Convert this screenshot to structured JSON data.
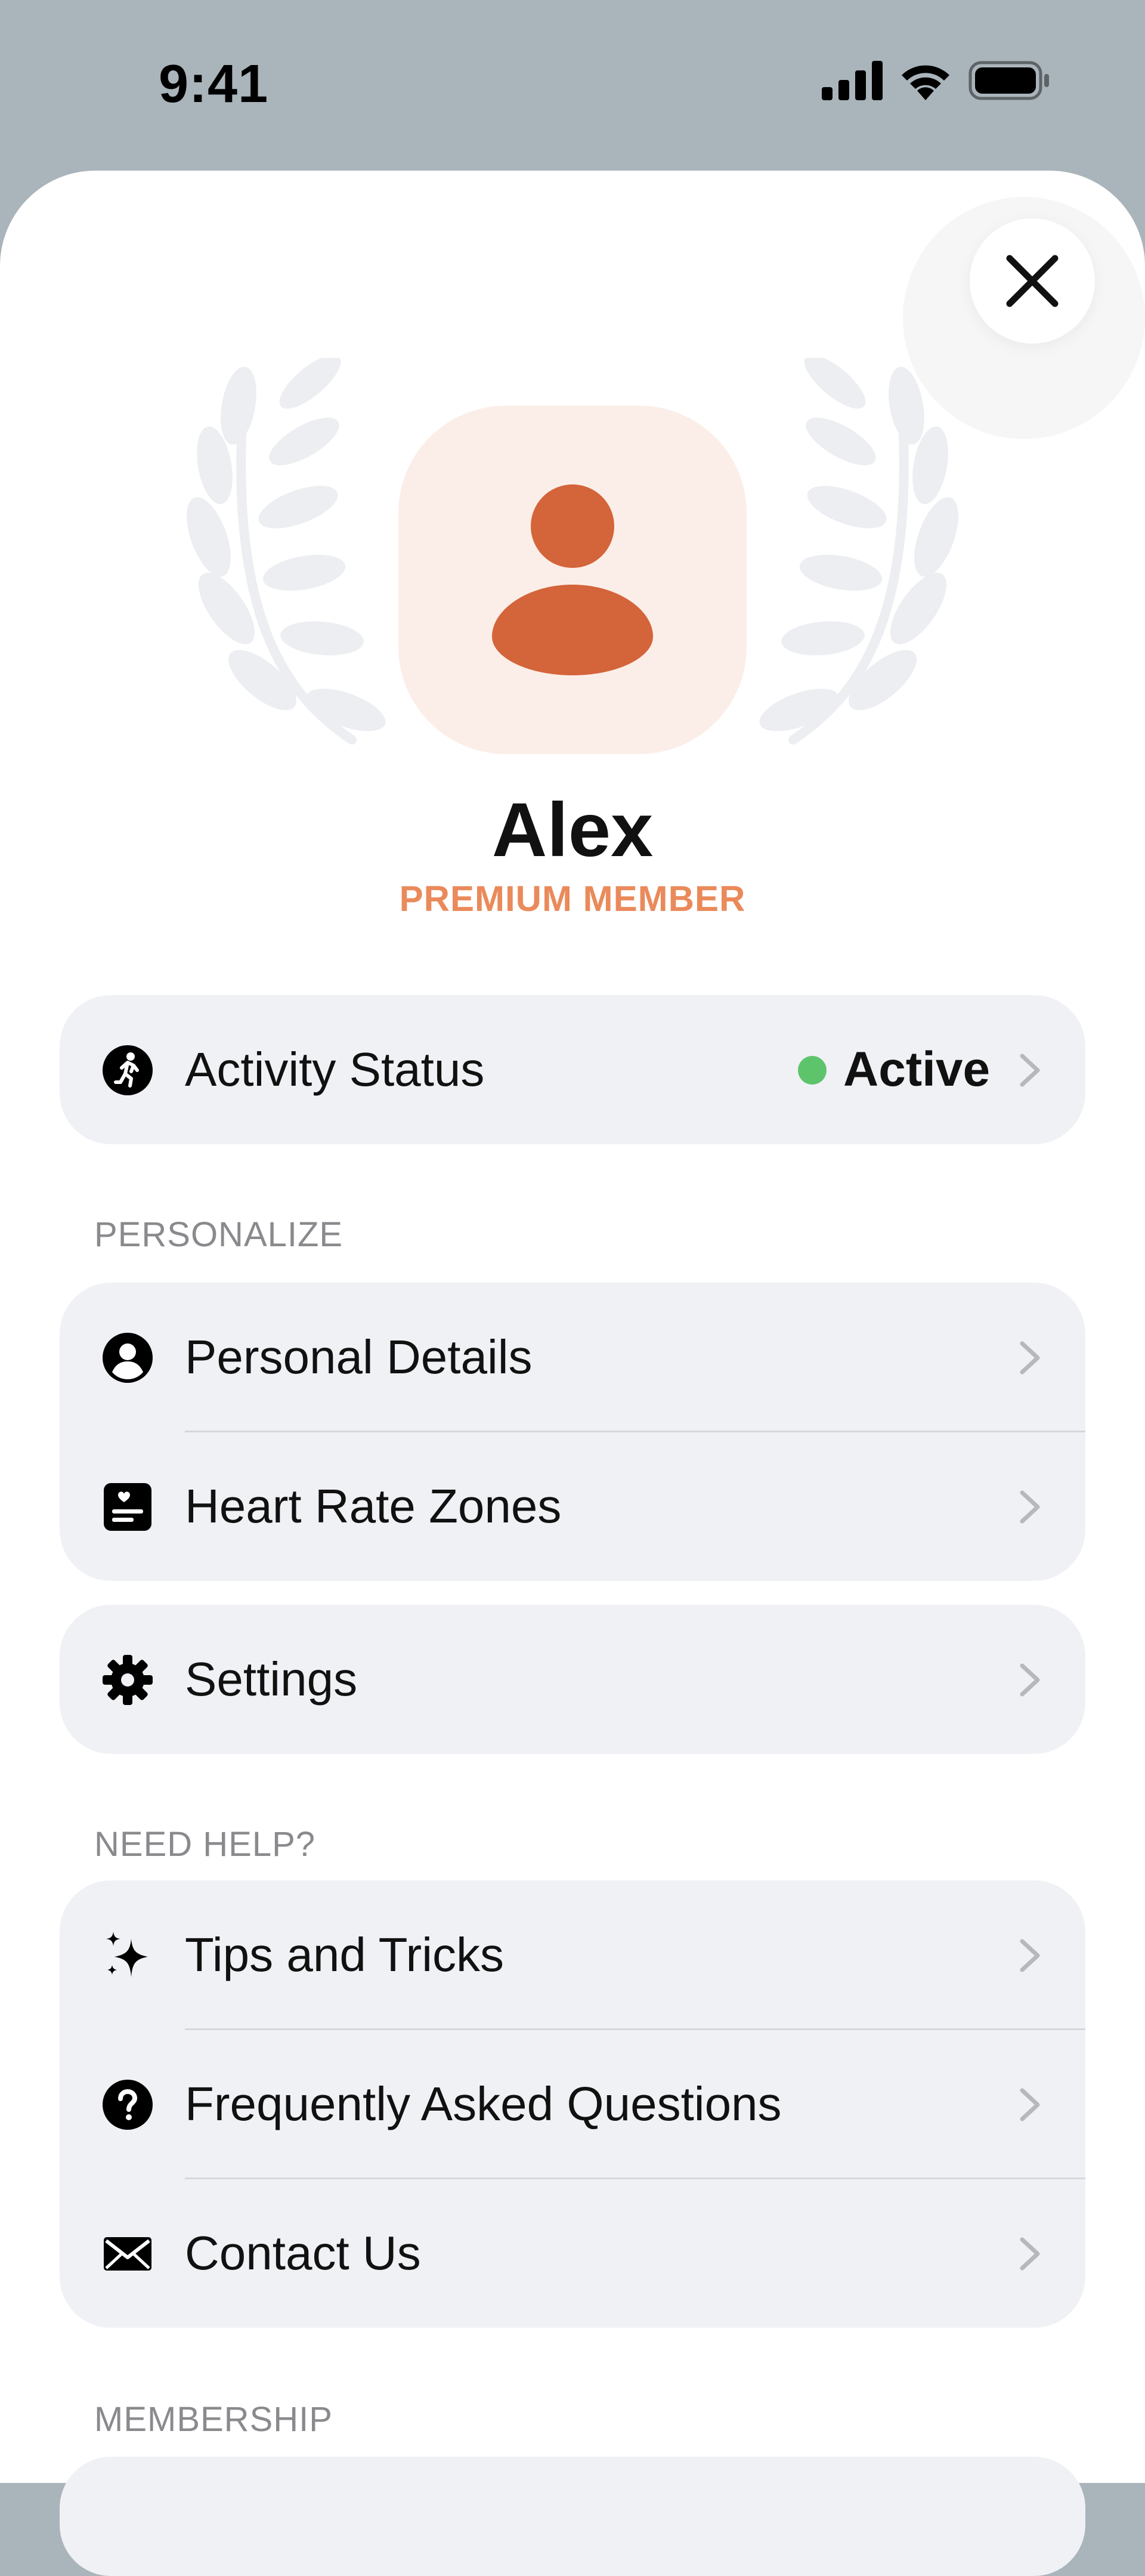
{
  "status_bar": {
    "time": "9:41"
  },
  "profile": {
    "name": "Alex",
    "tier": "PREMIUM MEMBER"
  },
  "activity": {
    "label": "Activity Status",
    "status": "Active",
    "status_color": "#5ec46b"
  },
  "sections": {
    "personalize": "PERSONALIZE",
    "need_help": "NEED HELP?",
    "membership": "MEMBERSHIP"
  },
  "personalize_items": [
    {
      "label": "Personal Details",
      "icon": "person-circle-icon"
    },
    {
      "label": "Heart Rate Zones",
      "icon": "heart-list-icon"
    }
  ],
  "settings_item": {
    "label": "Settings",
    "icon": "gear-icon"
  },
  "help_items": [
    {
      "label": "Tips and Tricks",
      "icon": "sparkles-icon"
    },
    {
      "label": "Frequently Asked Questions",
      "icon": "question-circle-icon"
    },
    {
      "label": "Contact Us",
      "icon": "envelope-icon"
    }
  ],
  "colors": {
    "accent": "#d4643a",
    "accent_light": "#fbeee8",
    "tier_text": "#ea8a5b",
    "card_bg": "#f0f1f5",
    "backdrop": "#aab4bb"
  }
}
